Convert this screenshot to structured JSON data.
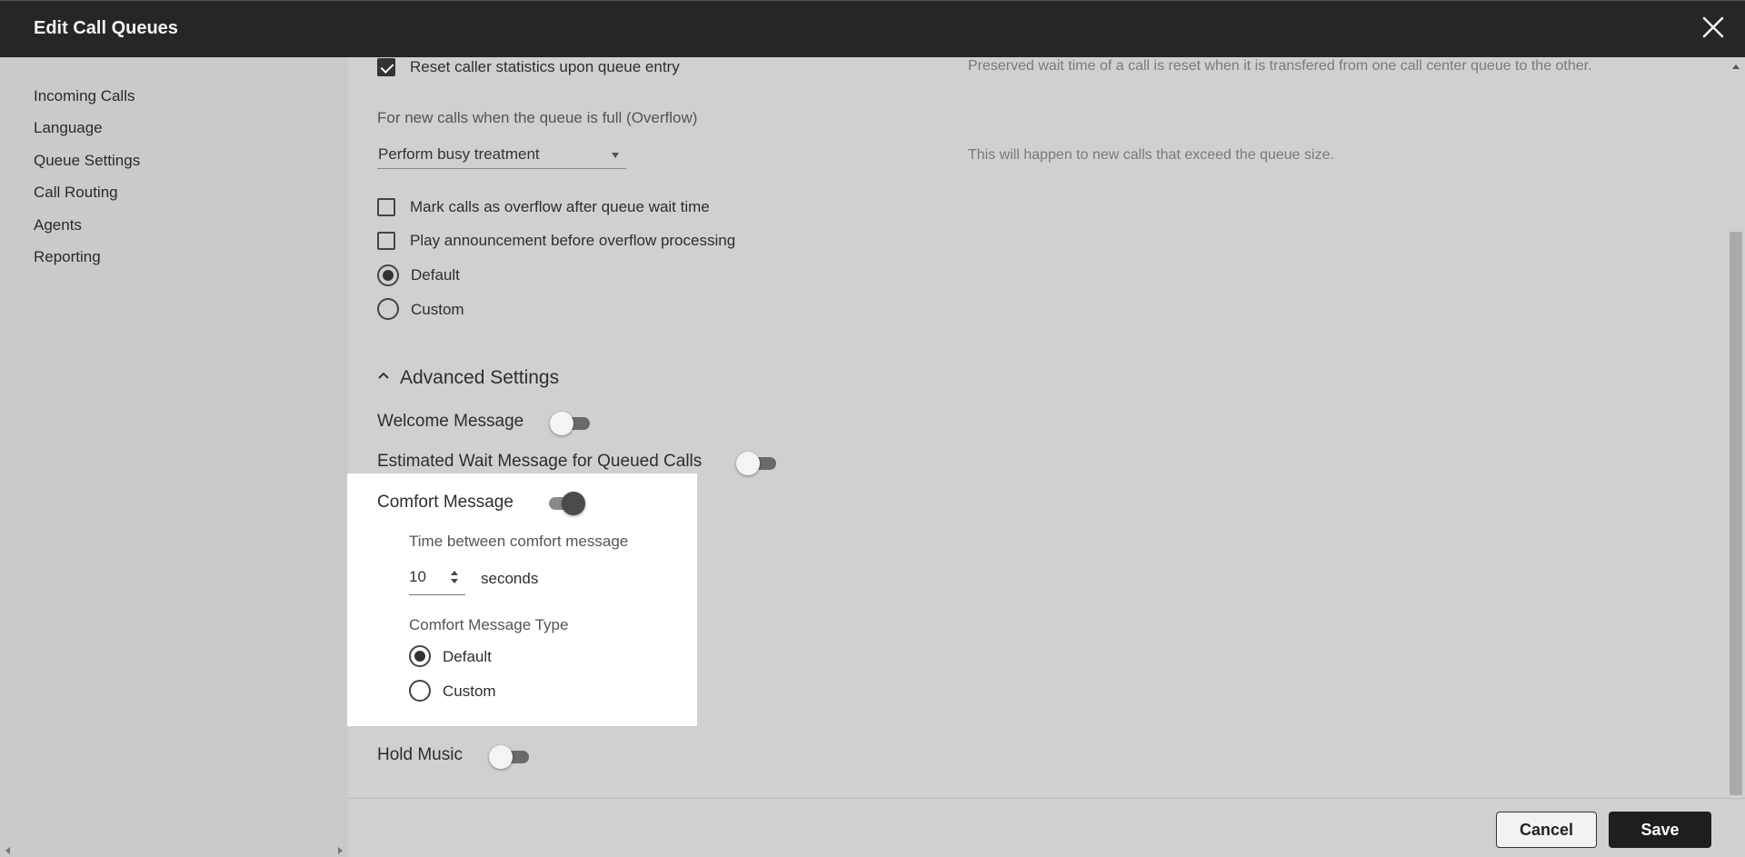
{
  "window": {
    "title": "Edit Call Queues"
  },
  "sidebar": {
    "items": [
      {
        "label": "Incoming Calls"
      },
      {
        "label": "Language"
      },
      {
        "label": "Queue Settings"
      },
      {
        "label": "Call Routing"
      },
      {
        "label": "Agents"
      },
      {
        "label": "Reporting"
      }
    ]
  },
  "queue": {
    "reset_stats": {
      "label": "Reset caller statistics upon queue entry",
      "checked": true,
      "hint": "Preserved wait time of a call is reset when it is transfered from one call center queue to the other."
    },
    "overflow": {
      "heading": "For new calls when the queue is full (Overflow)",
      "selected": "Perform busy treatment",
      "hint": "This will happen to new calls that exceed the queue size."
    },
    "mark_overflow": {
      "label": "Mark calls as overflow after queue wait time",
      "checked": false
    },
    "play_announcement": {
      "label": "Play announcement before overflow processing",
      "checked": false
    },
    "announcement_default": {
      "label": "Default",
      "selected": true
    },
    "announcement_custom": {
      "label": "Custom",
      "selected": false
    }
  },
  "advanced": {
    "heading": "Advanced Settings",
    "welcome": {
      "label": "Welcome Message",
      "on": false
    },
    "estimated_wait": {
      "label": "Estimated Wait Message for Queued Calls",
      "on": false
    },
    "comfort": {
      "label": "Comfort Message",
      "on": true,
      "interval_label": "Time between comfort message",
      "interval_value": "10",
      "interval_unit": "seconds",
      "type_label": "Comfort Message Type",
      "type_default": "Default",
      "type_custom": "Custom"
    },
    "hold_music": {
      "label": "Hold Music",
      "on": false
    }
  },
  "footer": {
    "cancel_label": "Cancel",
    "save_label": "Save"
  }
}
